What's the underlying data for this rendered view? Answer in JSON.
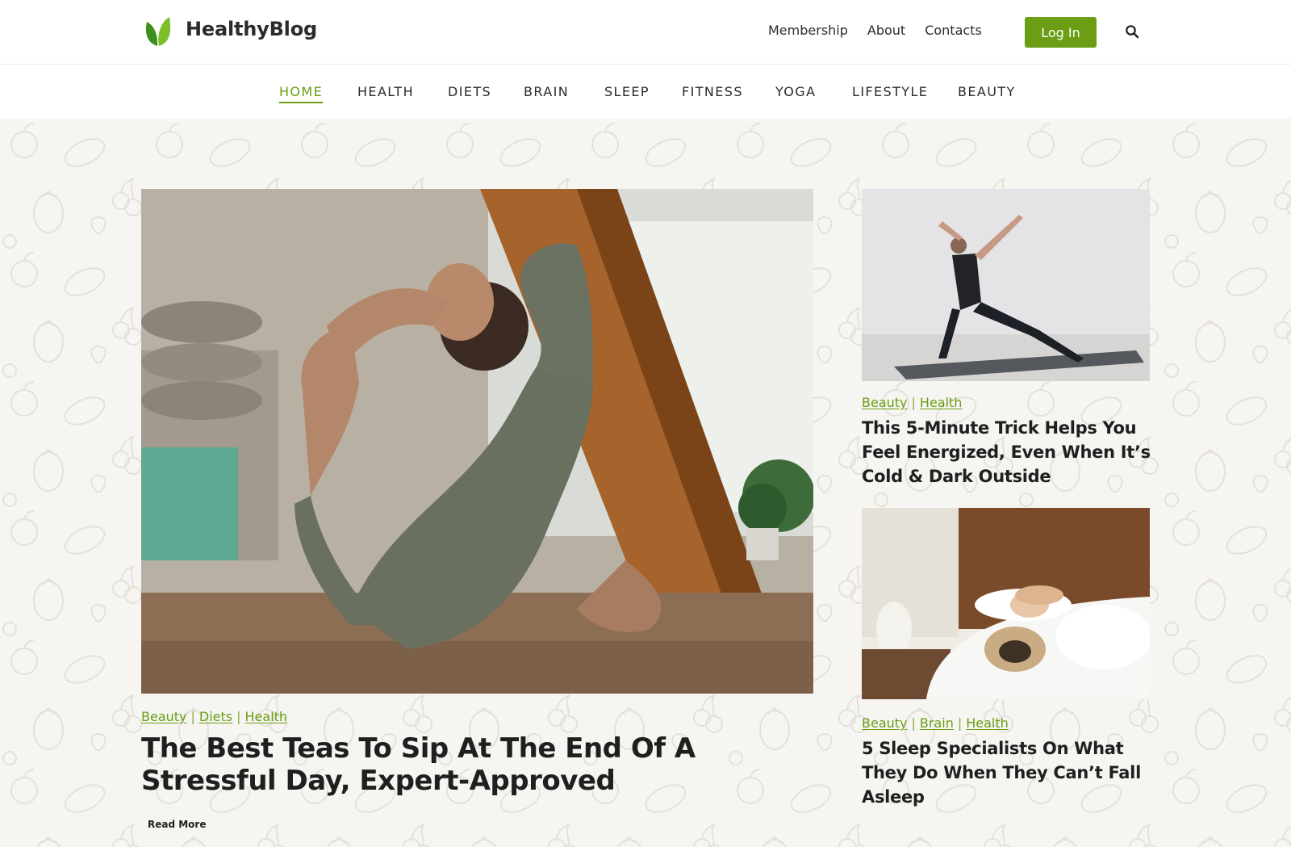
{
  "brand": {
    "name": "HealthyBlog",
    "logo_icon": "leaf-logo-icon",
    "accent_color": "#6b9e14"
  },
  "header": {
    "links": [
      {
        "label": "Membership"
      },
      {
        "label": "About"
      },
      {
        "label": "Contacts"
      }
    ],
    "login_label": "Log In",
    "search_icon": "search-icon"
  },
  "nav": {
    "items": [
      {
        "label": "HOME",
        "active": true
      },
      {
        "label": "HEALTH"
      },
      {
        "label": "DIETS"
      },
      {
        "label": "BRAIN"
      },
      {
        "label": "SLEEP"
      },
      {
        "label": "FITNESS"
      },
      {
        "label": "YOGA"
      },
      {
        "label": "LIFESTYLE"
      },
      {
        "label": "BEAUTY"
      }
    ]
  },
  "featured": {
    "image": "woman-yoga-stretch-photo",
    "tags": [
      "Beauty",
      "Diets",
      "Health"
    ],
    "title_line1": "The Best Teas To Sip At The End Of A",
    "title_line2": "Stressful Day, Expert-Approved",
    "read_more": "Read More"
  },
  "side_posts": [
    {
      "image": "yoga-pose-photo",
      "tags": [
        "Beauty",
        "Health"
      ],
      "title_line1": "This 5-Minute Trick Helps You",
      "title_line2": "Feel Energized, Even When It’s",
      "title_line3": "Cold & Dark Outside"
    },
    {
      "image": "woman-sleeping-with-pug-photo",
      "tags": [
        "Beauty",
        "Brain",
        "Health"
      ],
      "title_line1": "5 Sleep Specialists On What",
      "title_line2": "They Do When They Can’t Fall",
      "title_line3": "Asleep"
    }
  ]
}
